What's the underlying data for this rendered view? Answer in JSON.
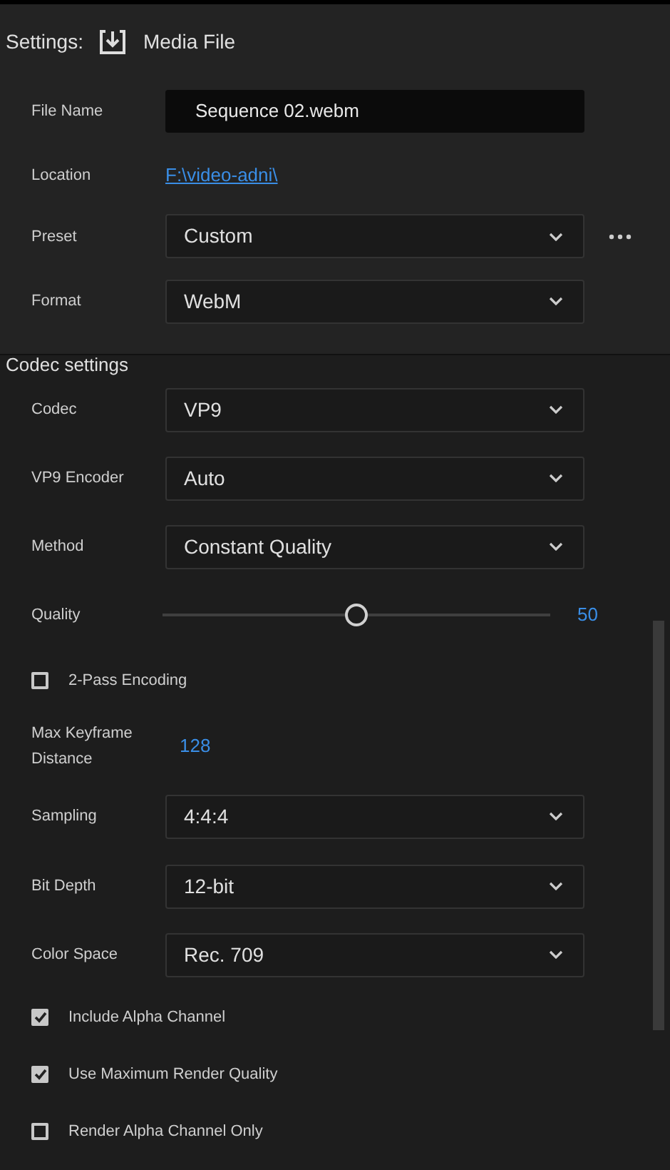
{
  "header": {
    "label": "Settings:",
    "title": "Media File"
  },
  "file_rows": [
    {
      "kind": "field",
      "label": "File Name",
      "value": "Sequence 02.webm"
    },
    {
      "kind": "link",
      "label": "Location",
      "value": "F:\\video-adni\\"
    },
    {
      "kind": "dropdown",
      "label": "Preset",
      "value": "Custom",
      "more": true
    },
    {
      "kind": "dropdown",
      "label": "Format",
      "value": "WebM"
    }
  ],
  "codec_section": {
    "title": "Codec settings",
    "rows": [
      {
        "kind": "dropdown",
        "label": "Codec",
        "value": "VP9"
      },
      {
        "kind": "dropdown",
        "label": "VP9 Encoder",
        "value": "Auto"
      },
      {
        "kind": "dropdown",
        "label": "Method",
        "value": "Constant Quality"
      },
      {
        "kind": "slider",
        "label": "Quality",
        "level": 0.5,
        "value": "50"
      },
      {
        "kind": "checkbox",
        "label": "2-Pass Encoding",
        "checked": false
      },
      {
        "kind": "value",
        "label": "Max Keyframe Distance",
        "value": "128"
      },
      {
        "kind": "dropdown",
        "label": "Sampling",
        "value": "4:4:4"
      },
      {
        "kind": "dropdown",
        "label": "Bit Depth",
        "value": "12-bit"
      },
      {
        "kind": "dropdown",
        "label": "Color Space",
        "value": "Rec. 709"
      },
      {
        "kind": "checkbox",
        "label": "Include Alpha Channel",
        "checked": true
      },
      {
        "kind": "checkbox",
        "label": "Use Maximum Render Quality",
        "checked": true
      },
      {
        "kind": "checkbox",
        "label": "Render Alpha Channel Only",
        "checked": false
      }
    ]
  }
}
